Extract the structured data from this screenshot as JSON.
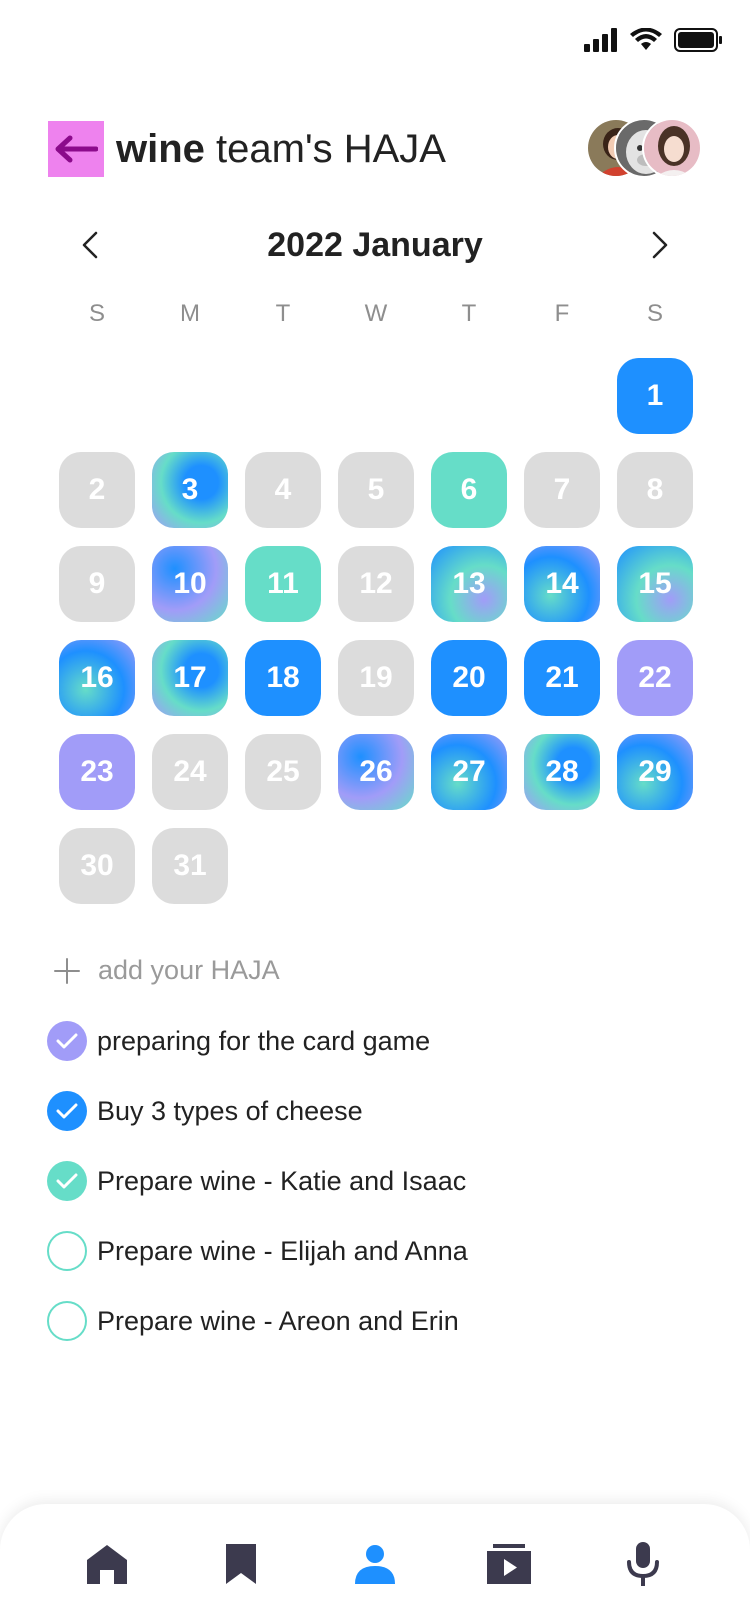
{
  "status_bar": {
    "icons": [
      "signal-icon",
      "wifi-icon",
      "battery-icon"
    ]
  },
  "header": {
    "back_icon": "arrow-left-icon",
    "title_bold": "wine",
    "title_rest": " team's HAJA",
    "avatars": [
      "avatar-woman-red",
      "avatar-dog",
      "avatar-woman-pink"
    ]
  },
  "calendar": {
    "month_label": "2022 January",
    "prev_icon": "chevron-left-icon",
    "next_icon": "chevron-right-icon",
    "weekdays": [
      "S",
      "M",
      "T",
      "W",
      "T",
      "F",
      "S"
    ],
    "leading_blanks": 6,
    "days": [
      {
        "label": "1",
        "style": "blue"
      },
      {
        "label": "2",
        "style": "gray"
      },
      {
        "label": "3",
        "style": "grad1"
      },
      {
        "label": "4",
        "style": "gray"
      },
      {
        "label": "5",
        "style": "gray"
      },
      {
        "label": "6",
        "style": "mint"
      },
      {
        "label": "7",
        "style": "gray"
      },
      {
        "label": "8",
        "style": "gray"
      },
      {
        "label": "9",
        "style": "gray"
      },
      {
        "label": "10",
        "style": "grad4"
      },
      {
        "label": "11",
        "style": "mint"
      },
      {
        "label": "12",
        "style": "gray"
      },
      {
        "label": "13",
        "style": "grad3"
      },
      {
        "label": "14",
        "style": "grad2"
      },
      {
        "label": "15",
        "style": "grad3"
      },
      {
        "label": "16",
        "style": "grad2"
      },
      {
        "label": "17",
        "style": "grad1"
      },
      {
        "label": "18",
        "style": "blue"
      },
      {
        "label": "19",
        "style": "gray"
      },
      {
        "label": "20",
        "style": "blue"
      },
      {
        "label": "21",
        "style": "blue"
      },
      {
        "label": "22",
        "style": "purple"
      },
      {
        "label": "23",
        "style": "purple"
      },
      {
        "label": "24",
        "style": "gray"
      },
      {
        "label": "25",
        "style": "gray"
      },
      {
        "label": "26",
        "style": "grad4"
      },
      {
        "label": "27",
        "style": "grad2"
      },
      {
        "label": "28",
        "style": "grad1"
      },
      {
        "label": "29",
        "style": "grad2"
      },
      {
        "label": "30",
        "style": "gray"
      },
      {
        "label": "31",
        "style": "gray"
      }
    ]
  },
  "add": {
    "icon": "plus-icon",
    "label": "add your HAJA"
  },
  "tasks": [
    {
      "label": "preparing for the card game",
      "checked": true,
      "color": "#a19cf8"
    },
    {
      "label": "Buy 3 types of cheese",
      "checked": true,
      "color": "#1e90ff"
    },
    {
      "label": "Prepare wine - Katie and Isaac",
      "checked": true,
      "color": "#66ddc8"
    },
    {
      "label": "Prepare wine - Elijah and Anna",
      "checked": false,
      "color": "#66ddc8"
    },
    {
      "label": "Prepare wine - Areon and Erin",
      "checked": false,
      "color": "#66ddc8"
    }
  ],
  "bottom_nav": {
    "items": [
      "home-icon",
      "bookmark-icon",
      "person-icon",
      "video-library-icon",
      "microphone-icon"
    ],
    "active": "person-icon",
    "active_color": "#1e90ff",
    "inactive_color": "#3c3a4e"
  },
  "colors": {
    "blue": "#1e90ff",
    "mint": "#66ddc8",
    "purple": "#a19cf8",
    "gray": "#dcdcdc",
    "back_button": "#ee82ee",
    "back_arrow": "#8b0a8b"
  }
}
